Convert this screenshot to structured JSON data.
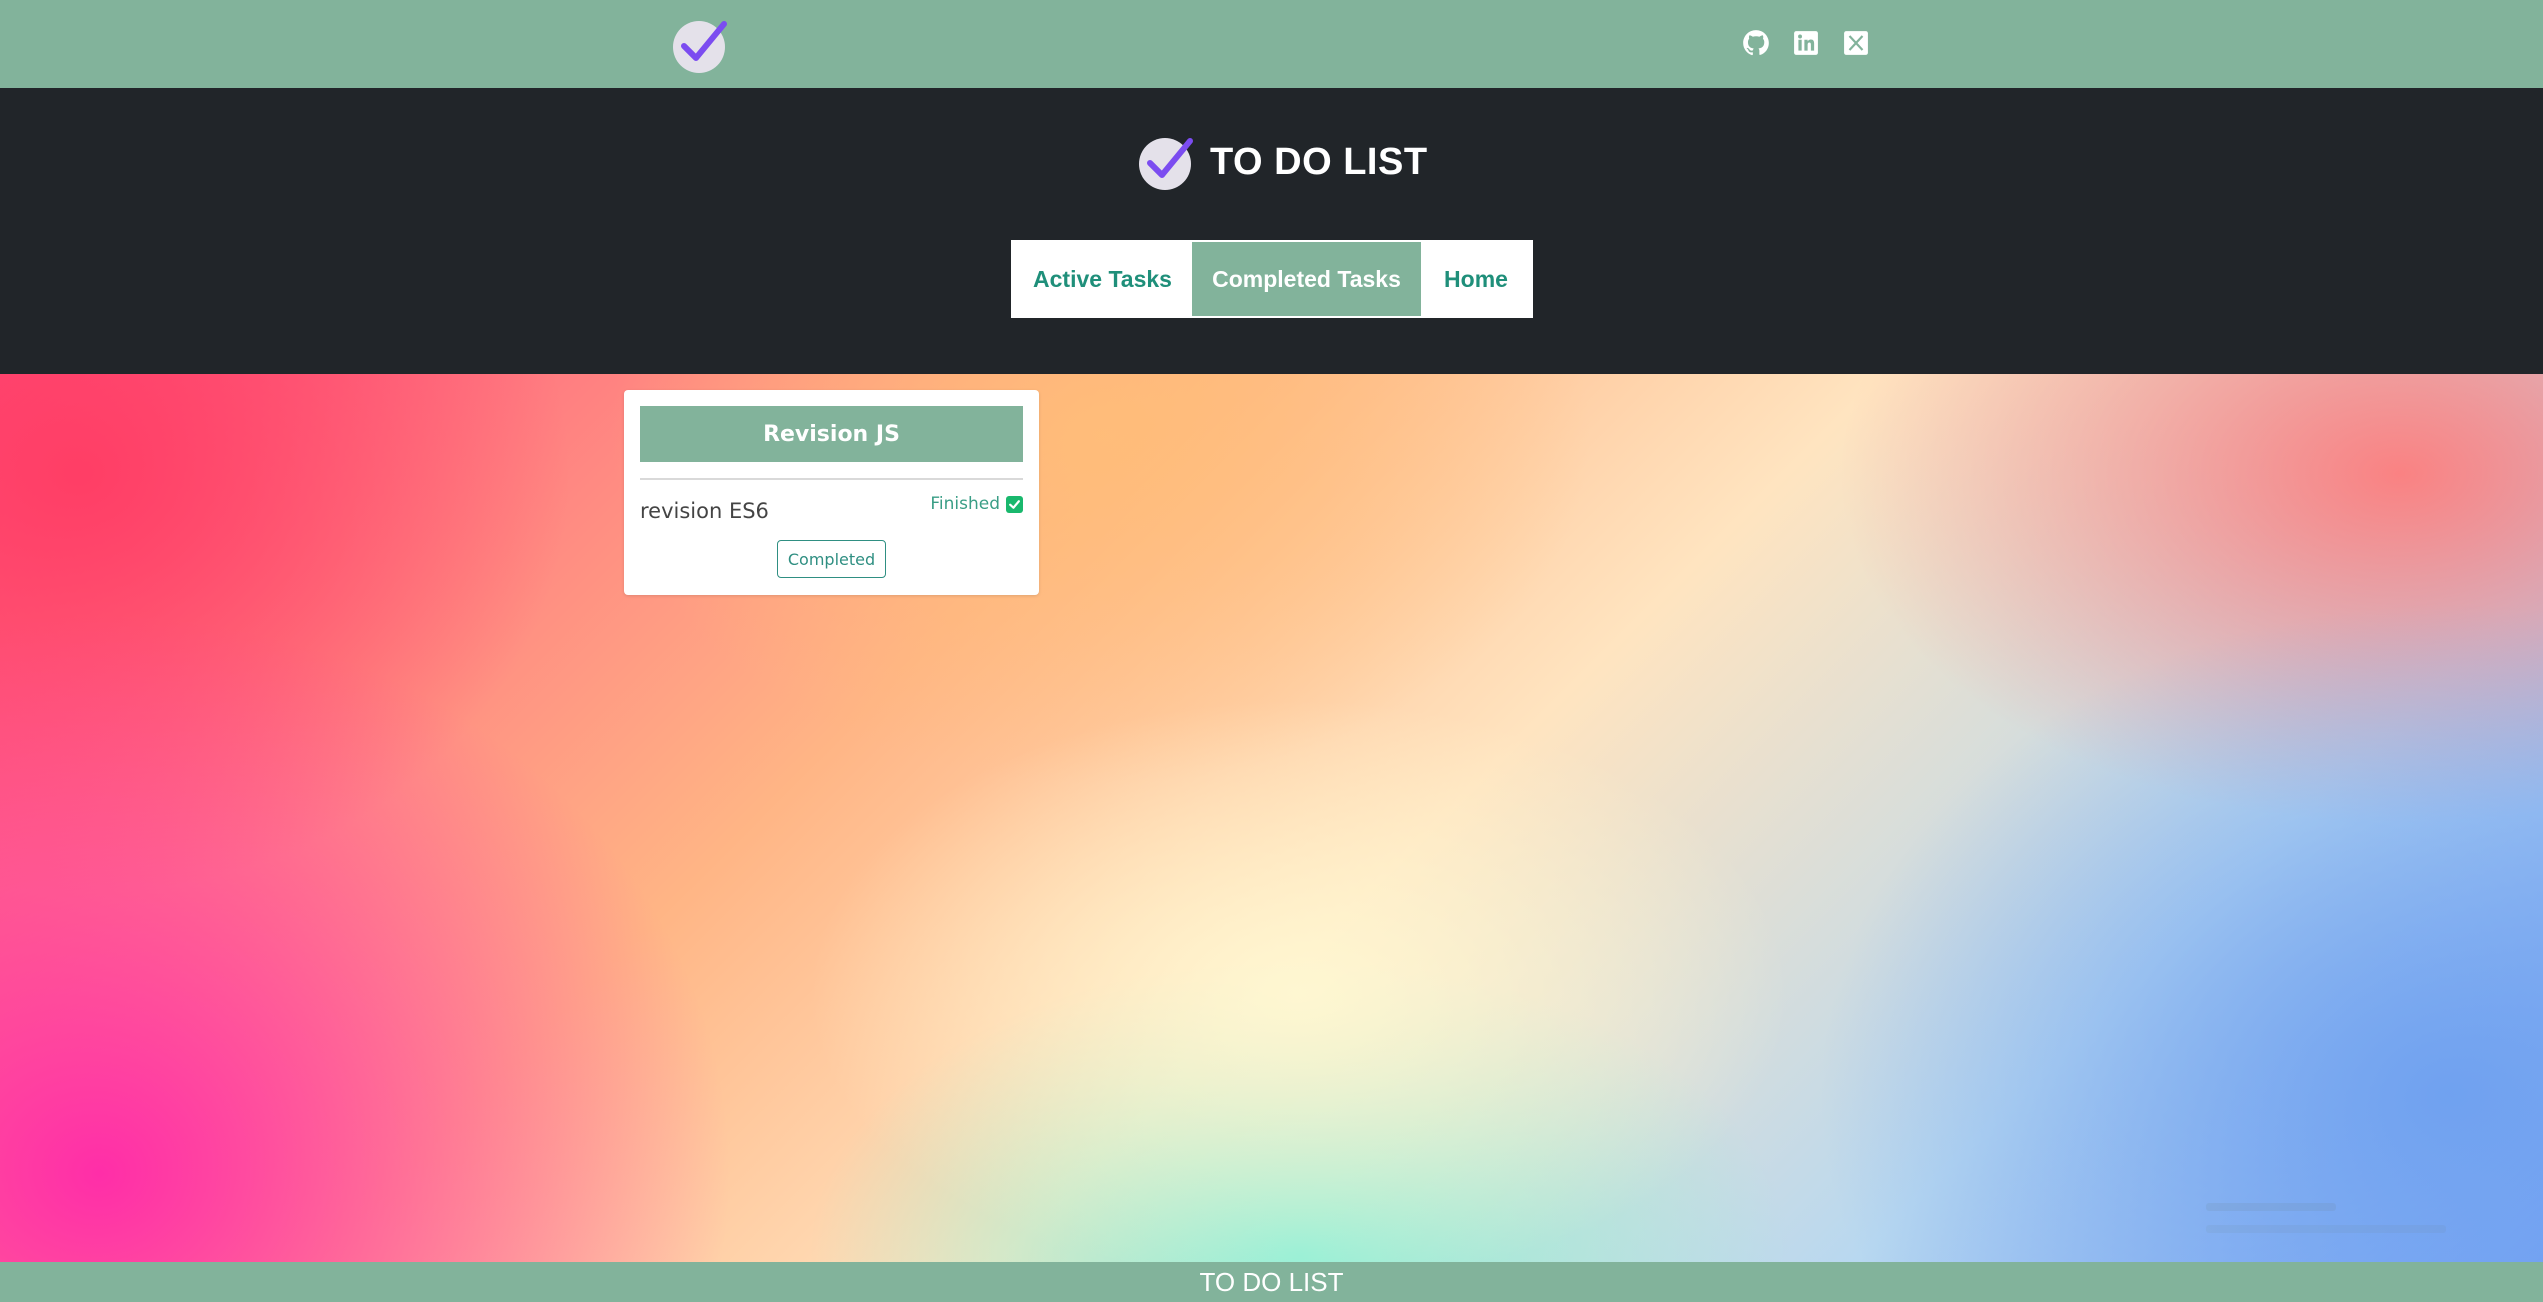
{
  "header": {
    "title": "TO DO LIST"
  },
  "nav": {
    "items": [
      {
        "label": "Active Tasks"
      },
      {
        "label": "Completed Tasks"
      },
      {
        "label": "Home"
      }
    ],
    "active": "Completed Tasks"
  },
  "socials": {
    "icons": [
      "github-icon",
      "linkedin-icon",
      "x-icon"
    ]
  },
  "card": {
    "title": "Revision JS",
    "task_name": "revision ES6",
    "finished_label": "Finished",
    "finished_checked": true,
    "status_button": "Completed"
  },
  "footer": {
    "text": "TO DO LIST"
  },
  "colors": {
    "accent": "#82b39b",
    "header_bg": "#212529",
    "nav_text": "#1f8f7a",
    "checkbox": "#19b86d"
  }
}
